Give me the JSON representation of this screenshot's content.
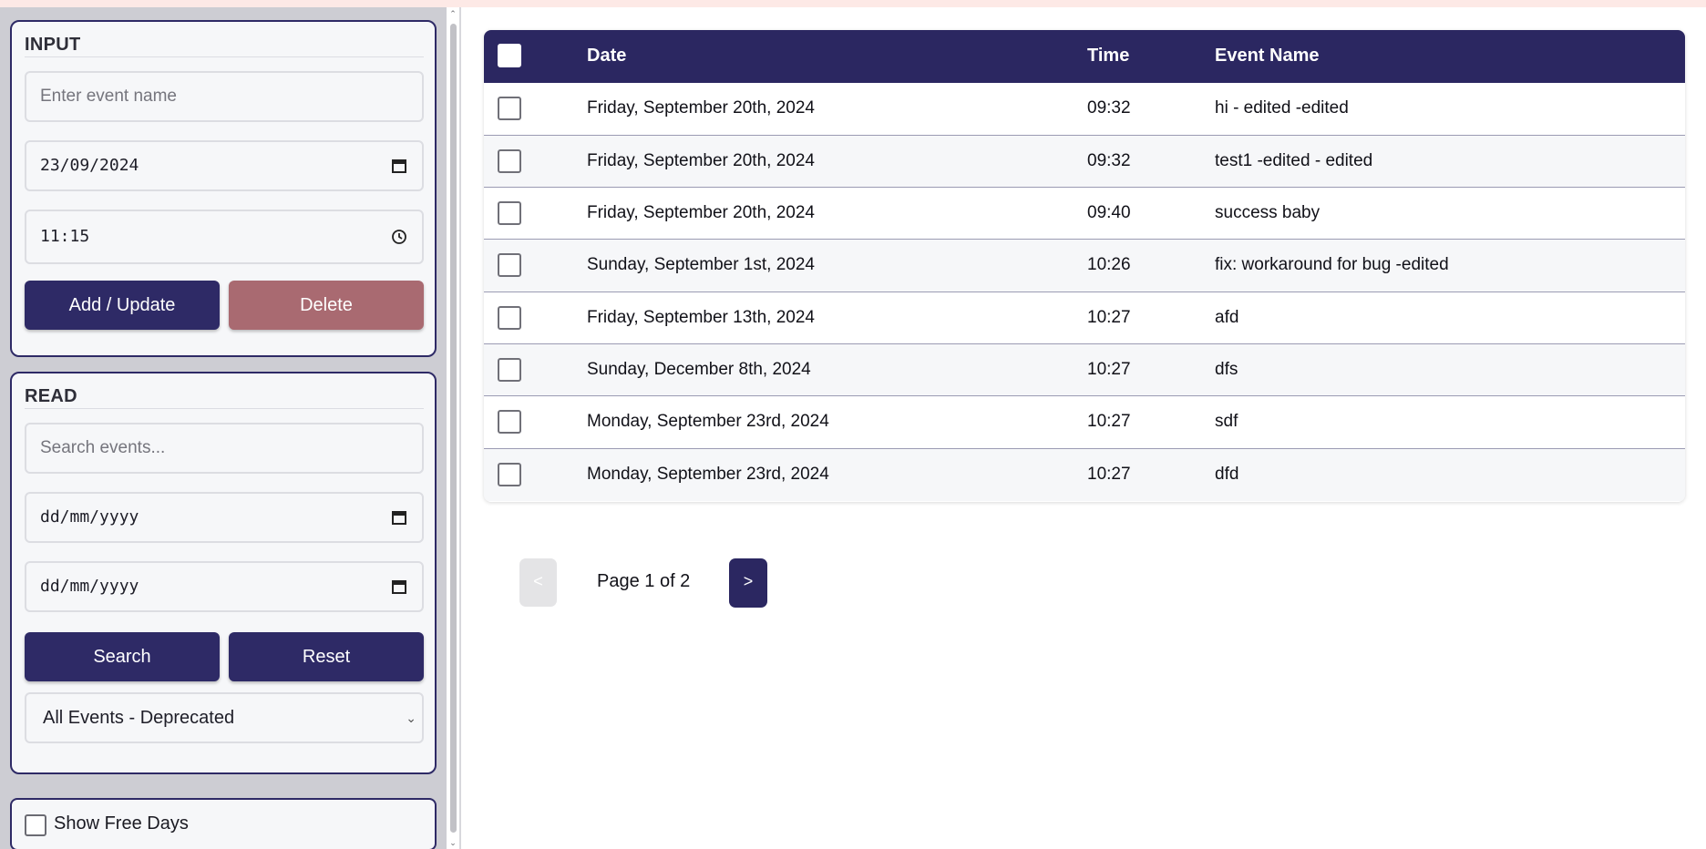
{
  "input_panel": {
    "title": "INPUT",
    "event_name_placeholder": "Enter event name",
    "date_value": "23/09/2024",
    "time_value": "11:15",
    "add_update_label": "Add / Update",
    "delete_label": "Delete"
  },
  "read_panel": {
    "title": "READ",
    "search_placeholder": "Search events...",
    "from_date_placeholder": "dd/mm/yyyy",
    "to_date_placeholder": "dd/mm/yyyy",
    "search_label": "Search",
    "reset_label": "Reset",
    "filter_selected": "All Events - Deprecated"
  },
  "free_days": {
    "label": "Show Free Days",
    "checked": false
  },
  "table": {
    "headers": {
      "date": "Date",
      "time": "Time",
      "event_name": "Event Name"
    },
    "rows": [
      {
        "date": "Friday, September 20th, 2024",
        "time": "09:32",
        "event": "hi - edited -edited"
      },
      {
        "date": "Friday, September 20th, 2024",
        "time": "09:32",
        "event": "test1 -edited - edited"
      },
      {
        "date": "Friday, September 20th, 2024",
        "time": "09:40",
        "event": "success baby"
      },
      {
        "date": "Sunday, September 1st, 2024",
        "time": "10:26",
        "event": "fix: workaround for bug -edited"
      },
      {
        "date": "Friday, September 13th, 2024",
        "time": "10:27",
        "event": "afd"
      },
      {
        "date": "Sunday, December 8th, 2024",
        "time": "10:27",
        "event": "dfs"
      },
      {
        "date": "Monday, September 23rd, 2024",
        "time": "10:27",
        "event": "sdf"
      },
      {
        "date": "Monday, September 23rd, 2024",
        "time": "10:27",
        "event": "dfd"
      }
    ]
  },
  "pagination": {
    "prev_label": "<",
    "page_text": "Page 1 of 2",
    "next_label": ">"
  },
  "colors": {
    "primary": "#2b2761",
    "delete": "#a96a71",
    "sidebar_bg": "#cdcdd3"
  },
  "icons": {
    "date_field": "calendar-icon",
    "time_field": "clock-icon",
    "select": "chevron-down-icon"
  }
}
